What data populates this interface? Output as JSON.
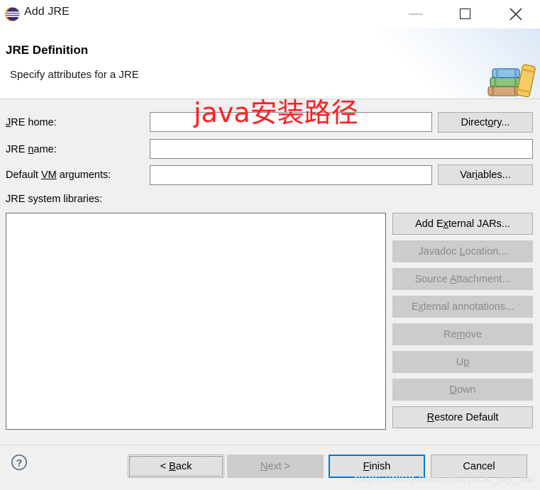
{
  "window": {
    "title": "Add JRE",
    "app_icon": "eclipse-icon",
    "controls": {
      "minimize": "minimize-icon",
      "maximize": "maximize-icon",
      "close": "close-icon"
    }
  },
  "header": {
    "title": "JRE Definition",
    "subtitle": "Specify attributes for a JRE",
    "banner_icon": "books-stack-icon"
  },
  "form": {
    "jre_home": {
      "label_pre": "",
      "label_mnemonic": "J",
      "label_post": "RE home:",
      "value": "",
      "placeholder": ""
    },
    "jre_name": {
      "label_pre": "JRE ",
      "label_mnemonic": "n",
      "label_post": "ame:",
      "value": "",
      "placeholder": ""
    },
    "vm_args": {
      "label_pre": "Default ",
      "label_mnemonic": "VM",
      "label_post": " arguments:",
      "value": "",
      "placeholder": ""
    },
    "system_libraries_label": "JRE system libraries:",
    "directory_button": {
      "pre": "Direct",
      "mn": "o",
      "post": "ry...",
      "enabled": true
    },
    "variables_button": {
      "pre": "Var",
      "mn": "i",
      "post": "ables...",
      "enabled": true
    }
  },
  "side_buttons": [
    {
      "pre": "Add E",
      "mn": "x",
      "post": "ternal JARs...",
      "enabled": true,
      "name": "add-external-jars-button"
    },
    {
      "pre": "Javadoc ",
      "mn": "L",
      "post": "ocation...",
      "enabled": false,
      "name": "javadoc-location-button"
    },
    {
      "pre": "Source ",
      "mn": "A",
      "post": "ttachment...",
      "enabled": false,
      "name": "source-attachment-button"
    },
    {
      "pre": "E",
      "mn": "x",
      "post": "ternal annotations...",
      "enabled": false,
      "name": "external-annotations-button"
    },
    {
      "pre": "Re",
      "mn": "m",
      "post": "ove",
      "enabled": false,
      "name": "remove-button"
    },
    {
      "pre": "U",
      "mn": "p",
      "post": "",
      "enabled": false,
      "name": "up-button"
    },
    {
      "pre": "",
      "mn": "D",
      "post": "own",
      "enabled": false,
      "name": "down-button"
    },
    {
      "pre": "",
      "mn": "R",
      "post": "estore Default",
      "enabled": true,
      "name": "restore-default-button"
    }
  ],
  "list": {
    "items": []
  },
  "footer": {
    "help_icon": "help-question-icon",
    "back": {
      "pre": "< ",
      "mn": "B",
      "post": "ack",
      "enabled": true,
      "focused": true,
      "default": false
    },
    "next": {
      "pre": "",
      "mn": "N",
      "post": "ext >",
      "enabled": false,
      "focused": false,
      "default": false
    },
    "finish": {
      "pre": "",
      "mn": "F",
      "post": "inish",
      "enabled": true,
      "focused": false,
      "default": true
    },
    "cancel": {
      "pre": "Cancel",
      "mn": "",
      "post": "",
      "enabled": true,
      "focused": false,
      "default": false
    }
  },
  "overlays": {
    "annotation_text": "java安装路径",
    "annotation_color": "#ff2020",
    "watermark_text": "https://blog.csdn.net/jack_jay_du",
    "watermark_color": "#e2e2e2"
  },
  "colors": {
    "dialog_bg": "#f0f0f0",
    "header_bg": "#ffffff",
    "field_bg": "#ffffff",
    "field_border": "#828790",
    "button_bg": "#e1e1e1",
    "button_border": "#adadad",
    "button_disabled_bg": "#cccccc",
    "button_disabled_text": "#8a8a8a",
    "accent_default_button": "#0078d7"
  }
}
